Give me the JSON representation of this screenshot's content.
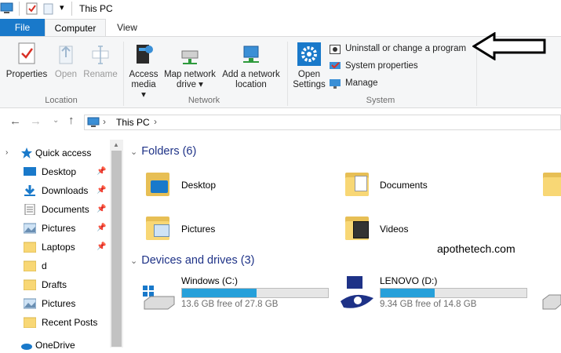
{
  "window": {
    "title": "This PC"
  },
  "tabs": {
    "file": "File",
    "computer": "Computer",
    "view": "View"
  },
  "ribbon": {
    "location": {
      "label": "Location",
      "properties": "Properties",
      "open": "Open",
      "rename": "Rename"
    },
    "network": {
      "label": "Network",
      "access_media": [
        "Access",
        "media ▾"
      ],
      "map_drive": [
        "Map network",
        "drive ▾"
      ],
      "add_location": [
        "Add a network",
        "location"
      ]
    },
    "system": {
      "label": "System",
      "open_settings": [
        "Open",
        "Settings"
      ],
      "uninstall": "Uninstall or change a program",
      "system_properties": "System properties",
      "manage": "Manage"
    }
  },
  "address": {
    "crumb_root": "This PC",
    "separator": "›"
  },
  "nav": {
    "items": [
      {
        "label": "Quick access",
        "icon": "star-icon"
      },
      {
        "label": "Desktop",
        "icon": "desktop-icon",
        "pinned": true
      },
      {
        "label": "Downloads",
        "icon": "download-icon",
        "pinned": true
      },
      {
        "label": "Documents",
        "icon": "documents-icon",
        "pinned": true
      },
      {
        "label": "Pictures",
        "icon": "pictures-icon",
        "pinned": true
      },
      {
        "label": "Laptops",
        "icon": "folder-icon",
        "pinned": true
      },
      {
        "label": "d",
        "icon": "folder-icon"
      },
      {
        "label": "Drafts",
        "icon": "folder-icon"
      },
      {
        "label": "Pictures",
        "icon": "pictures-icon"
      },
      {
        "label": "Recent Posts",
        "icon": "folder-icon"
      },
      {
        "label": "OneDrive",
        "icon": "cloud-icon"
      }
    ]
  },
  "folders": {
    "header": "Folders (6)",
    "items": [
      "Desktop",
      "Documents",
      "Pictures",
      "Videos"
    ]
  },
  "drives": {
    "header": "Devices and drives (3)",
    "items": [
      {
        "name": "Windows (C:)",
        "free": "13.6 GB free of 27.8 GB",
        "used_fraction": 0.51
      },
      {
        "name": "LENOVO (D:)",
        "free": "9.34 GB free of 14.8 GB",
        "used_fraction": 0.37
      }
    ]
  },
  "watermark": "apothetech.com",
  "colors": {
    "accent": "#1979ca",
    "drive_bar": "#26a0da",
    "folder": "#f8d775"
  }
}
